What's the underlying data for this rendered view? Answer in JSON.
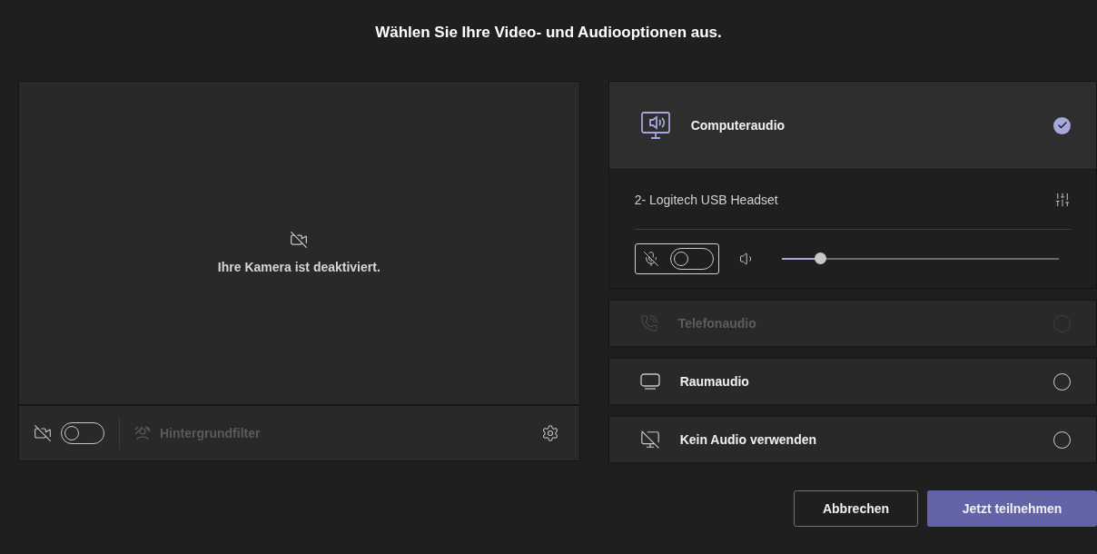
{
  "title": "Wählen Sie Ihre Video- und Audiooptionen aus.",
  "camera": {
    "on": false,
    "message": "Ihre Kamera ist deaktiviert.",
    "background_filter": {
      "label": "Hintergrundfilter",
      "disabled": true
    }
  },
  "audio_options": [
    {
      "kind": "computer",
      "label": "Computeraudio",
      "selected": true,
      "disabled": false,
      "device": {
        "name": "2- Logitech USB Headset",
        "mic_on": false,
        "volume": {
          "level": 0.14
        }
      }
    },
    {
      "kind": "phone",
      "label": "Telefonaudio",
      "selected": false,
      "disabled": true
    },
    {
      "kind": "room",
      "label": "Raumaudio",
      "selected": false,
      "disabled": false
    },
    {
      "kind": "none",
      "label": "Kein Audio verwenden",
      "selected": false,
      "disabled": false
    }
  ],
  "buttons": [
    {
      "kind": "secondary",
      "label": "Abbrechen"
    },
    {
      "kind": "primary",
      "label": "Jetzt teilnehmen"
    }
  ]
}
